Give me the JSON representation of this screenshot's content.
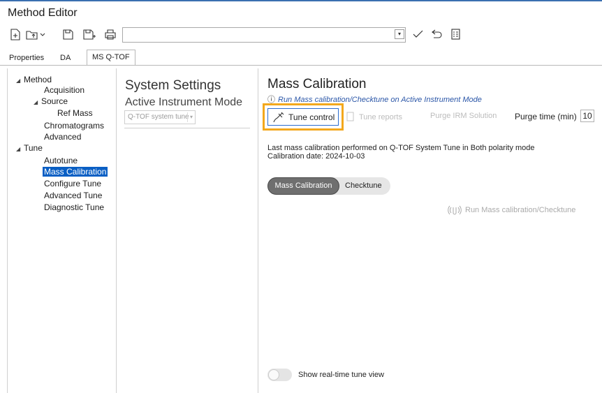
{
  "window": {
    "title": "Method Editor"
  },
  "toolbar": {
    "icons": [
      "new-method-icon",
      "open-method-icon",
      "save-icon",
      "save-as-icon",
      "print-icon",
      "check-icon",
      "undo-icon",
      "checklist-icon"
    ],
    "method_value": "",
    "combo_arrow": "▾"
  },
  "tabs": [
    {
      "label": "Properties"
    },
    {
      "label": "DA"
    },
    {
      "label": "MS Q-TOF"
    }
  ],
  "tree": {
    "method": "Method",
    "acquisition": "Acquisition",
    "source": "Source",
    "ref_mass": "Ref Mass",
    "chromatograms": "Chromatograms",
    "advanced": "Advanced",
    "tune": "Tune",
    "autotune": "Autotune",
    "mass_calibration": "Mass Calibration",
    "configure_tune": "Configure Tune",
    "advanced_tune": "Advanced Tune",
    "diagnostic_tune": "Diagnostic Tune",
    "expanded_arrow": "◢"
  },
  "settings": {
    "title": "System Settings",
    "subtitle": "Active Instrument Mode",
    "mode_value": "Q-TOF system tune",
    "mode_arrow": "▾"
  },
  "main": {
    "title": "Mass Calibration",
    "info_icon": "ⓘ",
    "info_text": "Run Mass calibration/Checktune on Active Instrument Mode",
    "tune_control_label": "Tune control",
    "tune_reports_label": "Tune reports",
    "purge_irm_label": "Purge IRM Solution",
    "purge_time_label": "Purge time (min)",
    "purge_time_value": "10",
    "last_cal_line1": "Last mass calibration performed on Q-TOF System Tune in Both polarity mode",
    "last_cal_line2": "Calibration date: 2024-10-03",
    "segment_mass_calibration": "Mass Calibration",
    "segment_checktune": "Checktune",
    "segment_selected": "Mass Calibration",
    "run_label": "Run Mass calibration/Checktune",
    "toggle_label": "Show real-time tune view",
    "toggle_on": false
  },
  "colors": {
    "accent": "#0a5fc4",
    "highlight": "#f3a81c",
    "info_link": "#2c57a8"
  }
}
